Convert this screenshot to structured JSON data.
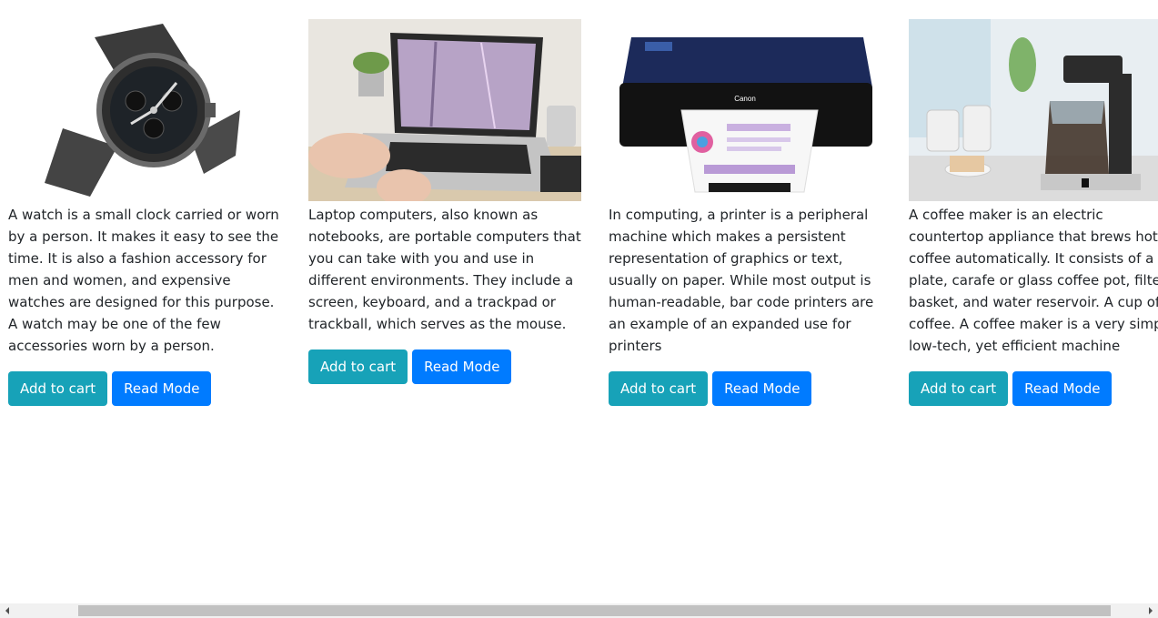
{
  "products": [
    {
      "image": "wristwatch-image",
      "description": "A watch is a small clock carried or worn by a person. It makes it easy to see the time. It is also a fashion accessory for men and women, and expensive watches are designed for this purpose. A watch may be one of the few accessories worn by a person.",
      "add_label": "Add to cart",
      "read_label": "Read Mode"
    },
    {
      "image": "laptop-image",
      "description": "Laptop computers, also known as notebooks, are portable computers that you can take with you and use in different environments. They include a screen, keyboard, and a trackpad or trackball, which serves as the mouse.",
      "add_label": "Add to cart",
      "read_label": "Read Mode"
    },
    {
      "image": "printer-image",
      "description": "In computing, a printer is a peripheral machine which makes a persistent representation of graphics or text, usually on paper. While most output is human-readable, bar code printers are an example of an expanded use for printers",
      "add_label": "Add to cart",
      "read_label": "Read Mode"
    },
    {
      "image": "coffee-maker-image",
      "description": "A coffee maker is an electric countertop appliance that brews hot coffee automatically. It consists of a hot plate, carafe or glass coffee pot, filter basket, and water reservoir. A cup of coffee. A coffee maker is a very simple, low-tech, yet efficient machine",
      "add_label": "Add to cart",
      "read_label": "Read Mode"
    }
  ],
  "colors": {
    "add_button": "#17a2b8",
    "read_button": "#007bff"
  }
}
